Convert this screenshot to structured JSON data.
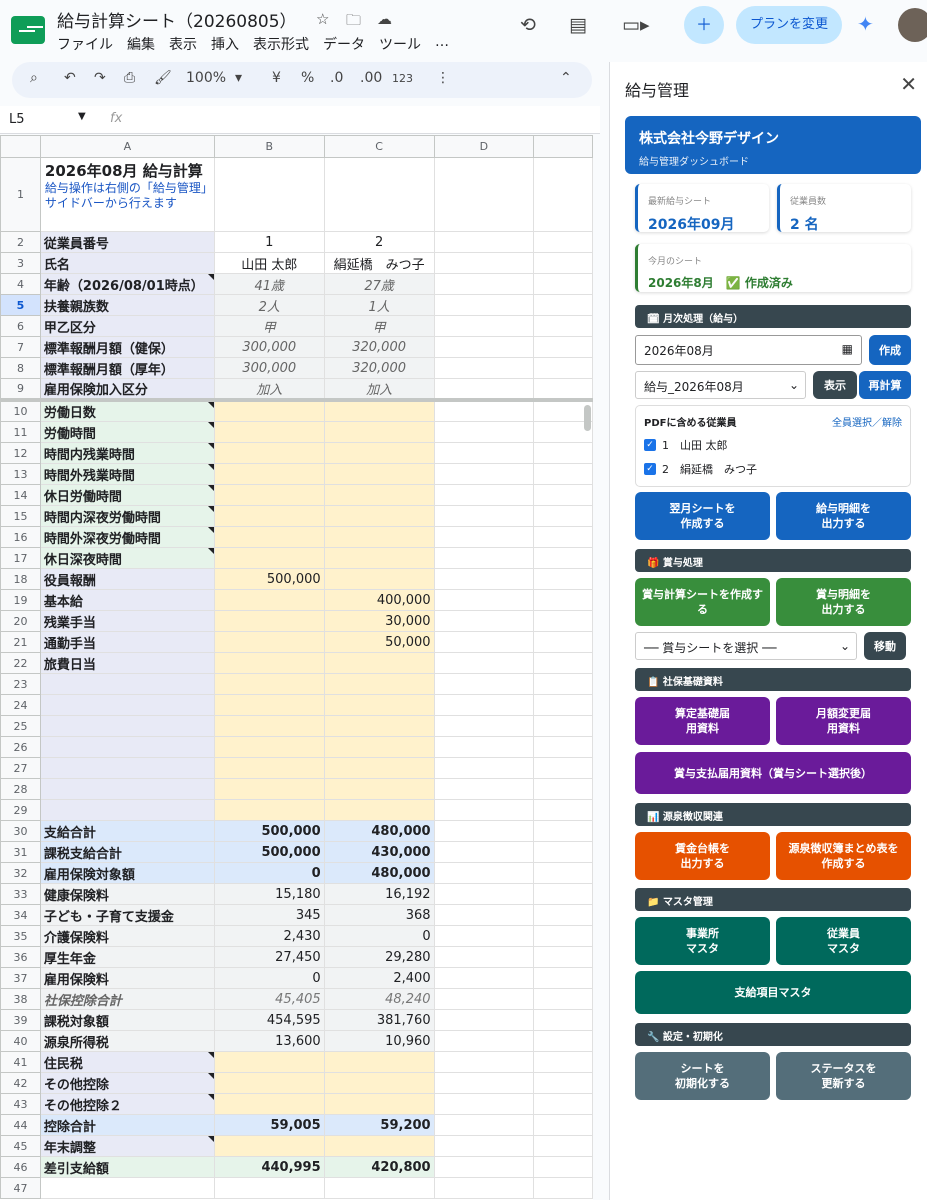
{
  "doc": {
    "title": "給与計算シート（20260805）",
    "menus": [
      "ファイル",
      "編集",
      "表示",
      "挿入",
      "表示形式",
      "データ",
      "ツール",
      "…"
    ],
    "share_icon": "add-person-icon",
    "plan_button": "プランを変更"
  },
  "toolbar": {
    "zoom": "100%",
    "currency": "¥",
    "percent": "%",
    "dec_dec": ".0",
    "dec_inc": ".00",
    "format_123": "123"
  },
  "formula": {
    "cell_ref": "L5",
    "fx": "fx",
    "value": ""
  },
  "grid": {
    "col_headers": [
      "A",
      "B",
      "C",
      "D"
    ],
    "title": "2026年08月 給与計算",
    "subtitle": "給与操作は右側の「給与管理」サイドバーから行えます",
    "rows": [
      {
        "n": "2",
        "a": "従業員番号",
        "b": "1",
        "c": "2",
        "style": "id"
      },
      {
        "n": "3",
        "a": "氏名",
        "b": "山田 太郎",
        "c": "絹延橋　みつ子",
        "style": "id"
      },
      {
        "n": "4",
        "a": "年齢（2026/08/01時点）",
        "b": "41歳",
        "c": "27歳",
        "style": "ital",
        "tri": true
      },
      {
        "n": "5",
        "a": "扶養親族数",
        "b": "2人",
        "c": "1人",
        "style": "ital"
      },
      {
        "n": "6",
        "a": "甲乙区分",
        "b": "甲",
        "c": "甲",
        "style": "ital"
      },
      {
        "n": "7",
        "a": "標準報酬月額（健保）",
        "b": "300,000",
        "c": "320,000",
        "style": "ital"
      },
      {
        "n": "8",
        "a": "標準報酬月額（厚年）",
        "b": "300,000",
        "c": "320,000",
        "style": "ital"
      },
      {
        "n": "9",
        "a": "雇用保険加入区分",
        "b": "加入",
        "c": "加入",
        "style": "ital"
      },
      {
        "n": "10",
        "a": "労働日数",
        "b": "",
        "c": "",
        "style": "work",
        "tri": true
      },
      {
        "n": "11",
        "a": "労働時間",
        "b": "",
        "c": "",
        "style": "work",
        "tri": true
      },
      {
        "n": "12",
        "a": "時間内残業時間",
        "b": "",
        "c": "",
        "style": "work",
        "tri": true
      },
      {
        "n": "13",
        "a": "時間外残業時間",
        "b": "",
        "c": "",
        "style": "work",
        "tri": true
      },
      {
        "n": "14",
        "a": "休日労働時間",
        "b": "",
        "c": "",
        "style": "work",
        "tri": true
      },
      {
        "n": "15",
        "a": "時間内深夜労働時間",
        "b": "",
        "c": "",
        "style": "work",
        "tri": true
      },
      {
        "n": "16",
        "a": "時間外深夜労働時間",
        "b": "",
        "c": "",
        "style": "work",
        "tri": true
      },
      {
        "n": "17",
        "a": "休日深夜時間",
        "b": "",
        "c": "",
        "style": "work",
        "tri": true
      },
      {
        "n": "18",
        "a": "役員報酬",
        "b": "500,000",
        "c": "",
        "style": "pay"
      },
      {
        "n": "19",
        "a": "基本給",
        "b": "",
        "c": "400,000",
        "style": "pay"
      },
      {
        "n": "20",
        "a": "残業手当",
        "b": "",
        "c": "30,000",
        "style": "pay"
      },
      {
        "n": "21",
        "a": "通勤手当",
        "b": "",
        "c": "50,000",
        "style": "pay"
      },
      {
        "n": "22",
        "a": "旅費日当",
        "b": "",
        "c": "",
        "style": "pay"
      },
      {
        "n": "23",
        "a": "",
        "b": "",
        "c": "",
        "style": "pay"
      },
      {
        "n": "24",
        "a": "",
        "b": "",
        "c": "",
        "style": "pay"
      },
      {
        "n": "25",
        "a": "",
        "b": "",
        "c": "",
        "style": "pay"
      },
      {
        "n": "26",
        "a": "",
        "b": "",
        "c": "",
        "style": "pay"
      },
      {
        "n": "27",
        "a": "",
        "b": "",
        "c": "",
        "style": "pay"
      },
      {
        "n": "28",
        "a": "",
        "b": "",
        "c": "",
        "style": "pay"
      },
      {
        "n": "29",
        "a": "",
        "b": "",
        "c": "",
        "style": "pay"
      },
      {
        "n": "30",
        "a": "支給合計",
        "b": "500,000",
        "c": "480,000",
        "style": "tot"
      },
      {
        "n": "31",
        "a": "課税支給合計",
        "b": "500,000",
        "c": "430,000",
        "style": "tot"
      },
      {
        "n": "32",
        "a": "雇用保険対象額",
        "b": "0",
        "c": "480,000",
        "style": "tot"
      },
      {
        "n": "33",
        "a": "健康保険料",
        "b": "15,180",
        "c": "16,192",
        "style": "ded"
      },
      {
        "n": "34",
        "a": "子ども・子育て支援金",
        "b": "345",
        "c": "368",
        "style": "ded"
      },
      {
        "n": "35",
        "a": "介護保険料",
        "b": "2,430",
        "c": "0",
        "style": "ded"
      },
      {
        "n": "36",
        "a": "厚生年金",
        "b": "27,450",
        "c": "29,280",
        "style": "ded"
      },
      {
        "n": "37",
        "a": "雇用保険料",
        "b": "0",
        "c": "2,400",
        "style": "ded"
      },
      {
        "n": "38",
        "a": "社保控除合計",
        "b": "45,405",
        "c": "48,240",
        "style": "sub"
      },
      {
        "n": "39",
        "a": "課税対象額",
        "b": "454,595",
        "c": "381,760",
        "style": "ded"
      },
      {
        "n": "40",
        "a": "源泉所得税",
        "b": "13,600",
        "c": "10,960",
        "style": "ded"
      },
      {
        "n": "41",
        "a": "住民税",
        "b": "",
        "c": "",
        "style": "inp",
        "tri": true
      },
      {
        "n": "42",
        "a": "その他控除",
        "b": "",
        "c": "",
        "style": "inp",
        "tri": true
      },
      {
        "n": "43",
        "a": "その他控除２",
        "b": "",
        "c": "",
        "style": "inp",
        "tri": true
      },
      {
        "n": "44",
        "a": "控除合計",
        "b": "59,005",
        "c": "59,200",
        "style": "tot"
      },
      {
        "n": "45",
        "a": "年末調整",
        "b": "",
        "c": "",
        "style": "inp",
        "tri": true
      },
      {
        "n": "46",
        "a": "差引支給額",
        "b": "440,995",
        "c": "420,800",
        "style": "net"
      },
      {
        "n": "47",
        "a": "",
        "b": "",
        "c": "",
        "style": "blank"
      }
    ]
  },
  "sidebar": {
    "title": "給与管理",
    "company": "株式会社今野デザイン",
    "dashboard": "給与管理ダッシュボード",
    "latest_label": "最新給与シート",
    "latest_value": "2026年09月",
    "emp_label": "従業員数",
    "emp_value": "2 名",
    "month_label": "今月のシート",
    "month_value": "2026年8月",
    "month_status": "✅ 作成済み",
    "sec_monthly": "🗓 月次処理（給与）",
    "date_value": "2026年08月",
    "create_btn": "作成",
    "sheet_select": "給与_2026年08月",
    "show_btn": "表示",
    "recalc_btn": "再計算",
    "pdf_header": "PDFに含める従業員",
    "select_all": "全員選択／解除",
    "employees": [
      "1　山田 太郎",
      "2　絹延橋　みつ子"
    ],
    "next_sheet_btn": "翌月シートを\n作成する",
    "payslip_btn": "給与明細を\n出力する",
    "sec_bonus": "🎁 賞与処理",
    "bonus_calc_btn": "賞与計算シートを作成する",
    "bonus_slip_btn": "賞与明細を\n出力する",
    "bonus_select": "── 賞与シートを選択 ──",
    "move_btn": "移動",
    "sec_social": "📋 社保基礎資料",
    "santei_btn": "算定基礎届\n用資料",
    "getsugaku_btn": "月額変更届\n用資料",
    "bonus_pay_btn": "賞与支払届用資料（賞与シート選択後）",
    "sec_tax": "📊 源泉徴収関連",
    "ledger_btn": "賃金台帳を\n出力する",
    "summary_btn": "源泉徴収簿まとめ表を\n作成する",
    "sec_master": "📁 マスタ管理",
    "office_btn": "事業所\nマスタ",
    "employee_btn": "従業員\nマスタ",
    "item_btn": "支給項目マスタ",
    "sec_settings": "🔧 設定・初期化",
    "init_btn": "シートを\n初期化する",
    "status_btn": "ステータスを\n更新する"
  }
}
